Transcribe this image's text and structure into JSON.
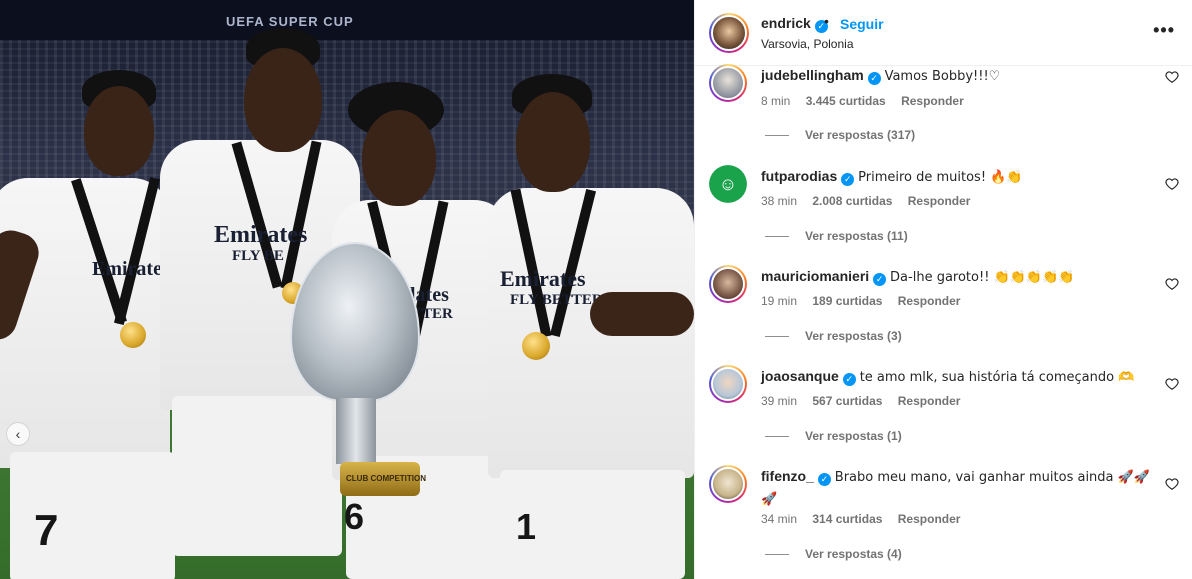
{
  "post": {
    "author": "endrick",
    "follow_label": "Seguir",
    "separator": "•",
    "location": "Varsovia, Polonia",
    "more_label": "•••",
    "photo_banner": "UEFA SUPER CUP"
  },
  "photo": {
    "sponsor_1": "Emirates",
    "sponsor_1b": "FLY BETTER",
    "sponsor_2": "Emirates",
    "sponsor_2b": "FLY BE",
    "sponsor_3": "lates",
    "sponsor_3b": "TTER",
    "sponsor_4": "Emirates",
    "sponsor_4b": "FLY BETTER",
    "number_left": "7",
    "number_mid": "6",
    "number_right": "1",
    "trophy_label": "CLUB COMPETITION"
  },
  "comments": [
    {
      "user": "judebellingham",
      "text": "Vamos Bobby!!!♡",
      "time": "8 min",
      "likes": "3.445 curtidas",
      "reply": "Responder",
      "replies": "Ver respostas (317)"
    },
    {
      "user": "futparodias",
      "text": "Primeiro de muitos! 🔥👏",
      "time": "38 min",
      "likes": "2.008 curtidas",
      "reply": "Responder",
      "replies": "Ver respostas (11)"
    },
    {
      "user": "mauriciomanieri",
      "text": "Da-lhe garoto!! 👏👏👏👏👏",
      "time": "19 min",
      "likes": "189 curtidas",
      "reply": "Responder",
      "replies": "Ver respostas (3)"
    },
    {
      "user": "joaosanque",
      "text": "te amo mlk, sua história tá começando 🫶",
      "time": "39 min",
      "likes": "567 curtidas",
      "reply": "Responder",
      "replies": "Ver respostas (1)"
    },
    {
      "user": "fifenzo_",
      "text": "Brabo meu mano, vai ganhar muitos ainda 🚀🚀🚀",
      "time": "34 min",
      "likes": "314 curtidas",
      "reply": "Responder",
      "replies": "Ver respostas (4)"
    }
  ],
  "icons": {
    "verified": "verified-badge-icon",
    "heart": "heart-icon",
    "more": "more-options-icon",
    "carousel_prev": "chevron-left-icon"
  },
  "colors": {
    "link_blue": "#0095f6",
    "meta_gray": "#737373",
    "text": "#262626"
  }
}
